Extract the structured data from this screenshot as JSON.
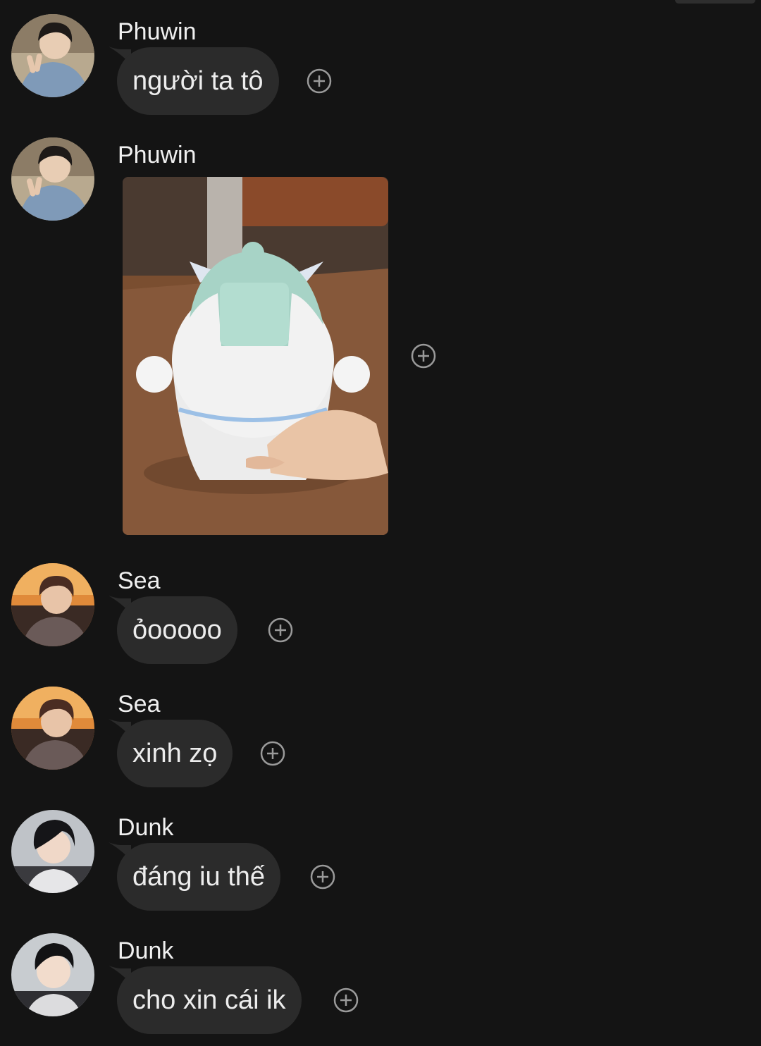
{
  "messages": [
    {
      "sender": "Phuwin",
      "text": "người ta tô"
    },
    {
      "sender": "Phuwin",
      "type": "image",
      "image": "unpainted-figurine-photo"
    },
    {
      "sender": "Sea",
      "text": "ỏooooo"
    },
    {
      "sender": "Sea",
      "text": "xinh zọ"
    },
    {
      "sender": "Dunk",
      "text": "đáng iu thế"
    },
    {
      "sender": "Dunk",
      "text": "cho xin cái ik"
    }
  ],
  "icons": {
    "reaction": "plus-circle-icon"
  },
  "colors": {
    "background": "#141414",
    "bubble": "#2b2b2b",
    "text": "#ececec"
  }
}
